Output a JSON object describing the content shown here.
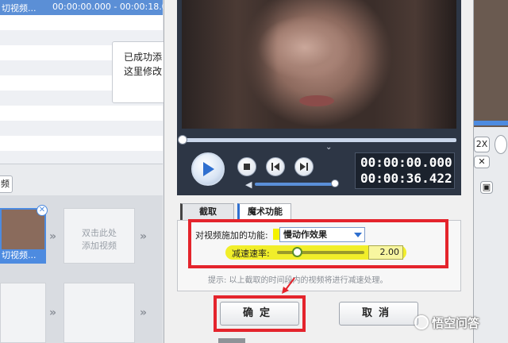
{
  "background": {
    "list_rows": [
      {
        "name": "切视频...",
        "range": "00:00:00.000 - 00:00:18.0"
      }
    ],
    "tip_lines": [
      "已成功添",
      "这里修改"
    ],
    "toolbar_button_label": "频",
    "first_clip_caption": "切视频...",
    "add_clip_label_1": "双击此处",
    "add_clip_label_2": "添加视频",
    "right_speed_label": "2X"
  },
  "dialog": {
    "time_current": "00:00:00.000",
    "time_total": "00:00:36.422",
    "tabs": [
      {
        "label": "截取"
      },
      {
        "label": "魔术功能"
      }
    ],
    "function_label": "对视频施加的功能:",
    "function_selected": "慢动作效果",
    "rate_label": "减速速率:",
    "rate_value": "2.00",
    "rate_fraction": 0.2,
    "hint": "提示: 以上截取的时间段内的视频将进行减速处理。",
    "ok_label": "确定",
    "cancel_label": "取消"
  },
  "watermark": "悟空问答",
  "colors": {
    "annotation_red": "#e4242c",
    "highlight_yellow": "#f1ee2a",
    "accent_blue": "#4d8be0",
    "player_bg": "#2d3645"
  }
}
